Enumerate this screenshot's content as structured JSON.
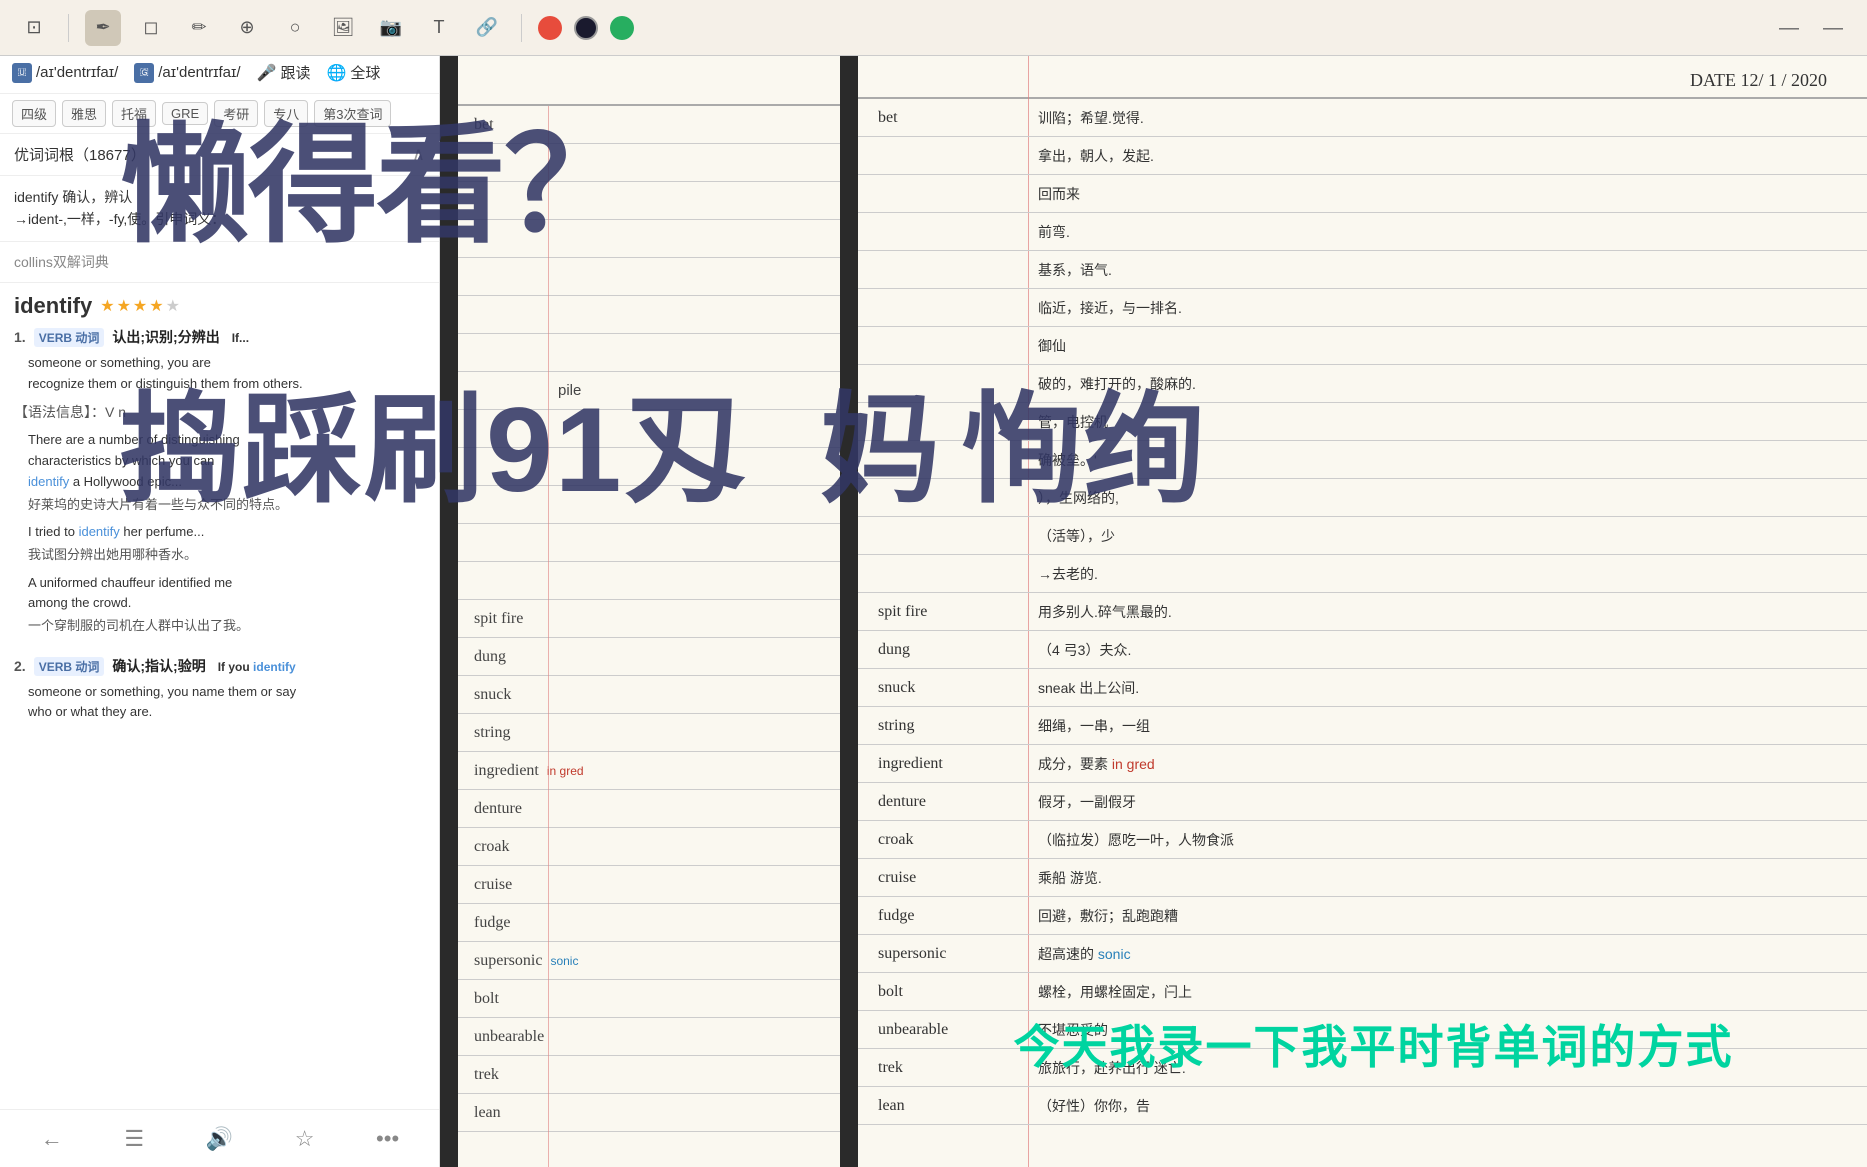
{
  "left_panel": {
    "stars": [
      true,
      false,
      false,
      false,
      false
    ],
    "phonetics": {
      "us": "/aɪ'dentrɪfaɪ/",
      "uk": "/aɪ'dentrɪfaɪ/",
      "follow_label": "跟读",
      "global_label": "全球"
    },
    "tags": [
      "四级",
      "雅思",
      "托福",
      "GRE",
      "考研",
      "专八",
      "第3次查词"
    ],
    "word_root_title": "优词词根（18677）",
    "root_text": "identify 确认，辨认\n→ident-,一样，-fy,使。引申词义：",
    "collins_label": "collins双解词典",
    "word": "identify",
    "word_rating": [
      true,
      true,
      true,
      true,
      false
    ],
    "definitions": [
      {
        "number": "1",
        "pos": "VERB 动词",
        "cn": "认出;识别;分辨出",
        "en": "If you identify someone or something, you recognize them or distinguish them from others.",
        "grammar": "【语法信息】：V n",
        "examples": [
          {
            "en": "There are a number of distinguishing characteristics by which you can identify a Hollywood epic...",
            "cn": "好莱坞的史诗大片有着一些与众不同的特点。"
          },
          {
            "en": "I tried to identify her perfume...",
            "cn": "我试图分辨出她用哪种香水。"
          },
          {
            "en": "A uniformed chauffeur identified me among the crowd.",
            "cn": "一个穿制服的司机在人群中认出了我。"
          }
        ]
      },
      {
        "number": "2",
        "pos": "VERB 动词",
        "cn": "确认;指认;验明",
        "en": "If you identify someone or something, you name them or say what they are.",
        "grammar": "",
        "examples": []
      }
    ]
  },
  "right_toolbar": {
    "tools": [
      "⊡",
      "✒",
      "◻",
      "✏",
      "⊕",
      "○",
      "🖼",
      "📷",
      "T",
      "🔗"
    ],
    "colors": [
      "#e74c3c",
      "#2c2c2c",
      "#27ae60"
    ],
    "minimize_label": "—",
    "close_label": "—"
  },
  "overlay": {
    "top_text": "懒得看？",
    "bottom_left_text": "捣踩刷91刄",
    "bottom_right_parts": [
      "妈",
      "恂绚"
    ]
  },
  "notebook_right": {
    "date": "DATE 12/ 1 / 2020",
    "lines": [
      {
        "word": "bet",
        "meaning": "训陷；希望.觉得."
      },
      {
        "word": "",
        "meaning": "拿出，朝人，发起."
      },
      {
        "word": "",
        "meaning": "回而来"
      },
      {
        "word": "",
        "meaning": "前弯."
      },
      {
        "word": "",
        "meaning": "基系，语气."
      },
      {
        "word": "",
        "meaning": "临近，接近，与一排名."
      },
      {
        "word": "",
        "meaning": "御仙"
      },
      {
        "word": "",
        "meaning": "破的，难打开的，酸麻的."
      },
      {
        "word": "",
        "meaning": "管，电控机"
      },
      {
        "word": "",
        "meaning": "确被垒。'"
      },
      {
        "word": "",
        "meaning": "），生网络的,"
      },
      {
        "word": "",
        "meaning": "（活等），少"
      },
      {
        "word": "",
        "meaning": "→去老的."
      },
      {
        "word": "spit fire",
        "meaning": "用多别人.碎气黑最的."
      },
      {
        "word": "dung",
        "meaning": "（4 弓3）夫众."
      },
      {
        "word": "snuck",
        "meaning": "sneak 出上公间."
      },
      {
        "word": "string",
        "meaning": "细绳，一串，一组"
      },
      {
        "word": "ingredient",
        "meaning": "成分，要素",
        "red_note": "in gred"
      },
      {
        "word": "denture",
        "meaning": "假牙，一副假牙"
      },
      {
        "word": "croak",
        "meaning": "（临拉发）愿吃一叶，人物食派"
      },
      {
        "word": "cruise",
        "meaning": "乘船 游览."
      },
      {
        "word": "fudge",
        "meaning": "回避，敷衍；乱跑跑糟"
      },
      {
        "word": "supersonic",
        "meaning": "超高速的",
        "blue_note": "sonic"
      },
      {
        "word": "bolt",
        "meaning": "螺栓，用螺栓固定，闩上"
      },
      {
        "word": "unbearable",
        "meaning": "不堪忍受的"
      },
      {
        "word": "trek",
        "meaning": "旅旅行，赴养出行  迷亡."
      },
      {
        "word": "lean",
        "meaning": "（好性）你你，告"
      }
    ]
  },
  "bottom_subtitle": "今天我录一下我平时背单词的方式"
}
